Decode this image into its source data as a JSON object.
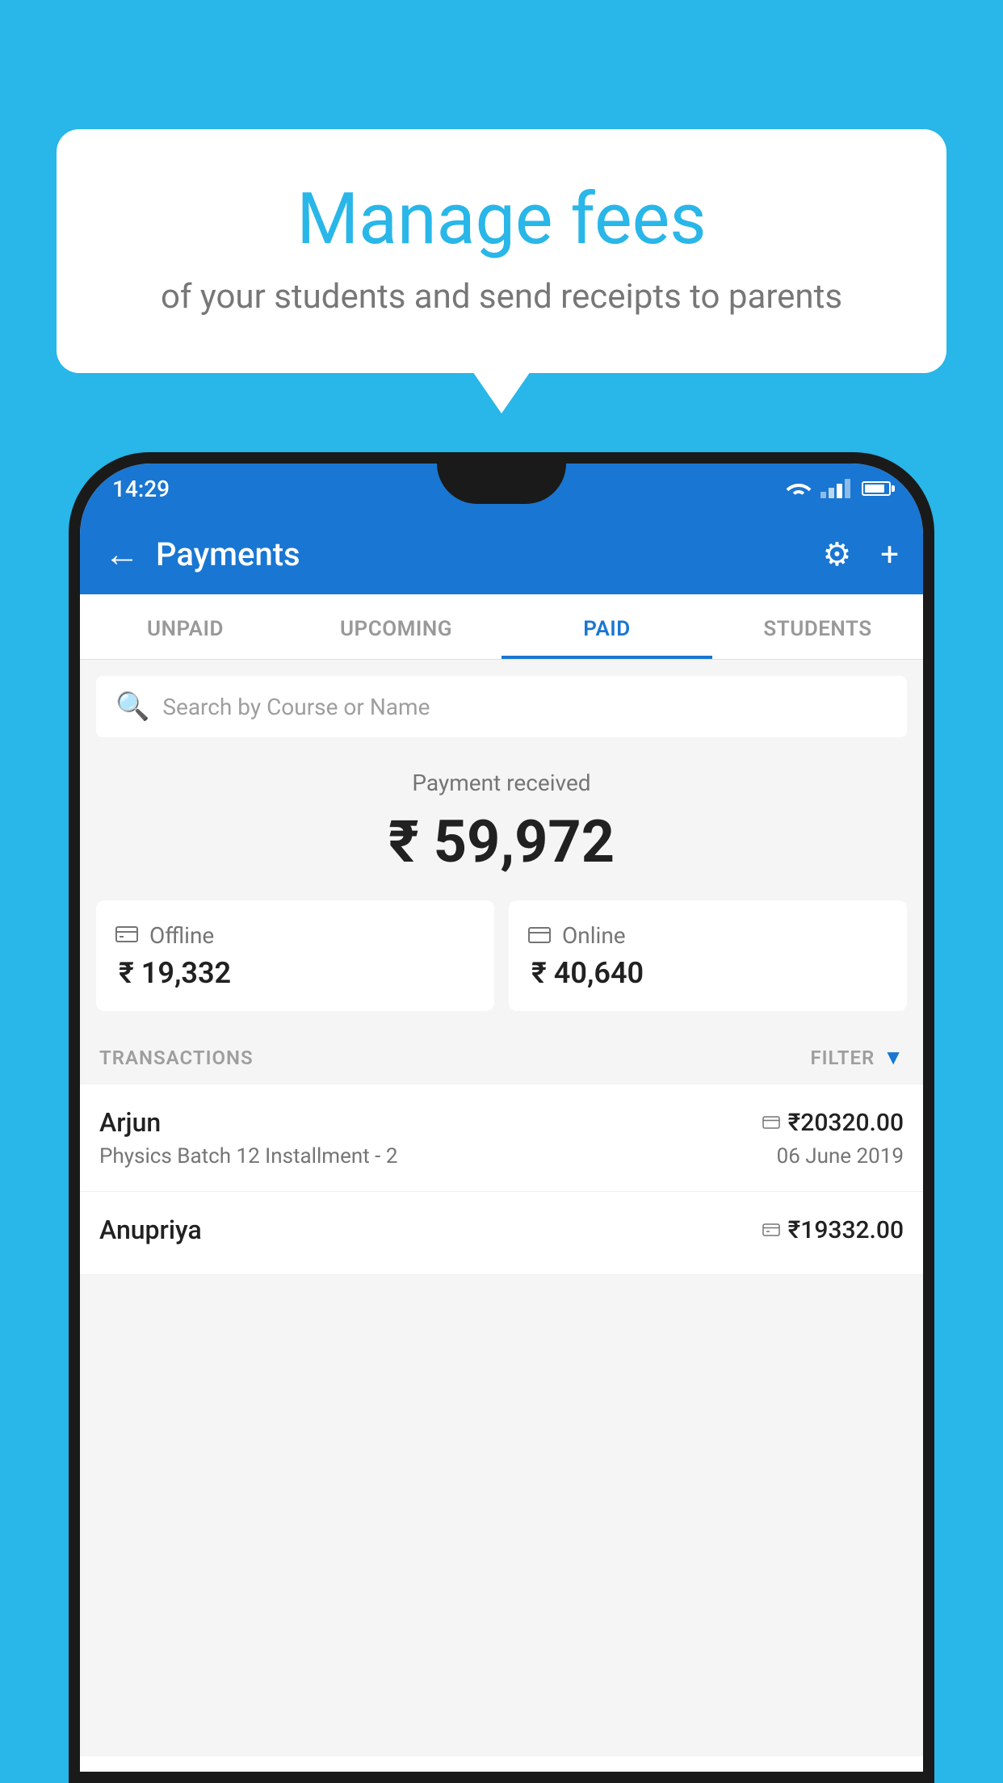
{
  "background_color": "#29b6e8",
  "bubble": {
    "title": "Manage fees",
    "subtitle": "of your students and send receipts to parents"
  },
  "status_bar": {
    "time": "14:29"
  },
  "app_bar": {
    "title": "Payments",
    "back_label": "←",
    "settings_label": "⚙",
    "add_label": "+"
  },
  "tabs": [
    {
      "label": "UNPAID",
      "active": false
    },
    {
      "label": "UPCOMING",
      "active": false
    },
    {
      "label": "PAID",
      "active": true
    },
    {
      "label": "STUDENTS",
      "active": false
    }
  ],
  "search": {
    "placeholder": "Search by Course or Name"
  },
  "payment": {
    "label": "Payment received",
    "amount": "₹ 59,972"
  },
  "cards": [
    {
      "type": "Offline",
      "amount": "₹ 19,332",
      "icon": "💳"
    },
    {
      "type": "Online",
      "amount": "₹ 40,640",
      "icon": "💳"
    }
  ],
  "transactions_label": "TRANSACTIONS",
  "filter_label": "FILTER",
  "transactions": [
    {
      "name": "Arjun",
      "amount": "₹20320.00",
      "course": "Physics Batch 12 Installment - 2",
      "date": "06 June 2019",
      "payment_type": "online"
    },
    {
      "name": "Anupriya",
      "amount": "₹19332.00",
      "course": "",
      "date": "",
      "payment_type": "offline"
    }
  ]
}
